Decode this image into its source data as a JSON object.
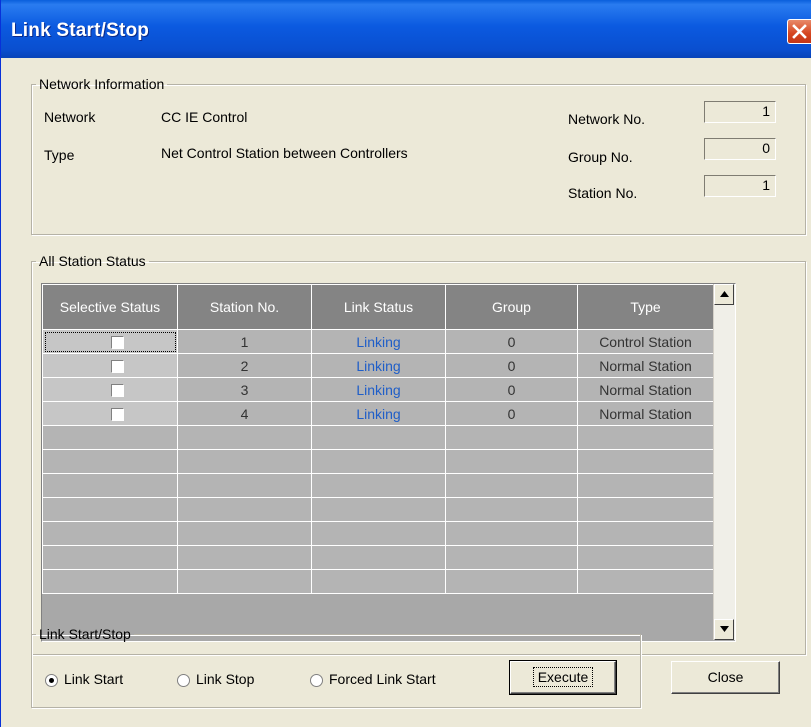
{
  "window": {
    "title": "Link Start/Stop"
  },
  "network_info": {
    "legend": "Network Information",
    "network_label": "Network",
    "network_value": "CC IE Control",
    "type_label": "Type",
    "type_value": "Net Control Station between Controllers",
    "network_no_label": "Network No.",
    "network_no_value": "1",
    "group_no_label": "Group No.",
    "group_no_value": "0",
    "station_no_label": "Station No.",
    "station_no_value": "1"
  },
  "station_status": {
    "legend": "All Station Status",
    "columns": [
      "Selective Status",
      "Station No.",
      "Link Status",
      "Group",
      "Type"
    ],
    "rows": [
      {
        "checked": false,
        "station_no": "1",
        "link_status": "Linking",
        "group": "0",
        "type": "Control Station"
      },
      {
        "checked": false,
        "station_no": "2",
        "link_status": "Linking",
        "group": "0",
        "type": "Normal Station"
      },
      {
        "checked": false,
        "station_no": "3",
        "link_status": "Linking",
        "group": "0",
        "type": "Normal Station"
      },
      {
        "checked": false,
        "station_no": "4",
        "link_status": "Linking",
        "group": "0",
        "type": "Normal Station"
      }
    ],
    "empty_rows": 7
  },
  "link_control": {
    "legend": "Link Start/Stop",
    "options": [
      {
        "label": "Link Start",
        "selected": true
      },
      {
        "label": "Link Stop",
        "selected": false
      },
      {
        "label": "Forced Link Start",
        "selected": false
      }
    ],
    "execute_label": "Execute",
    "close_label": "Close"
  },
  "colors": {
    "titlebar": "#0a4fd0",
    "header": "#848484",
    "cell": "#b4b4b4",
    "link_text": "#1f5ec8",
    "close": "#d5451f"
  },
  "icons": {
    "close": "close-icon",
    "scroll_up": "arrow-up-icon",
    "scroll_down": "arrow-down-icon"
  }
}
